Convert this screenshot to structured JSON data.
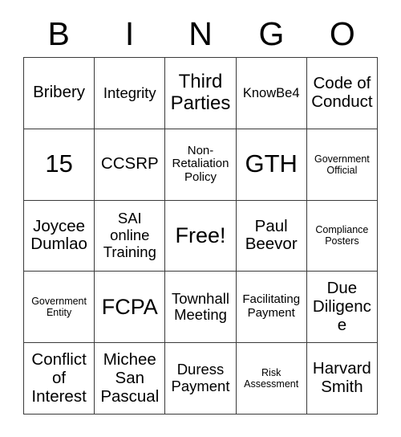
{
  "card": {
    "title": "BINGO Card",
    "header_letters": [
      "B",
      "I",
      "N",
      "G",
      "O"
    ],
    "columns": 5,
    "rows": 5,
    "colors": {
      "background": "#ffffff",
      "text": "#000000",
      "grid_line": "#3a3a3a"
    },
    "cells": [
      {
        "text": "Bribery",
        "size": "fs-l"
      },
      {
        "text": "Integrity",
        "size": "fs-ml"
      },
      {
        "text": "Third Parties",
        "size": "fs-xl"
      },
      {
        "text": "KnowBe4",
        "size": "fs-m"
      },
      {
        "text": "Code of Conduct",
        "size": "fs-l"
      },
      {
        "text": "15",
        "size": "fs-3xl"
      },
      {
        "text": "CCSRP",
        "size": "fs-l"
      },
      {
        "text": "Non-Retaliation Policy",
        "size": "fs-s"
      },
      {
        "text": "GTH",
        "size": "fs-3xl"
      },
      {
        "text": "Government Official",
        "size": "fs-xs"
      },
      {
        "text": "Joycee Dumlao",
        "size": "fs-l"
      },
      {
        "text": "SAI online Training",
        "size": "fs-ml"
      },
      {
        "text": "Free!",
        "size": "fs-2xl"
      },
      {
        "text": "Paul Beevor",
        "size": "fs-l"
      },
      {
        "text": "Compliance Posters",
        "size": "fs-xs"
      },
      {
        "text": "Government Entity",
        "size": "fs-xs"
      },
      {
        "text": "FCPA",
        "size": "fs-2xl"
      },
      {
        "text": "Townhall Meeting",
        "size": "fs-ml"
      },
      {
        "text": "Facilitating Payment",
        "size": "fs-s"
      },
      {
        "text": "Due Diligence",
        "size": "fs-l"
      },
      {
        "text": "Conflict of Interest",
        "size": "fs-l"
      },
      {
        "text": "Michee San Pascual",
        "size": "fs-l"
      },
      {
        "text": "Duress Payment",
        "size": "fs-ml"
      },
      {
        "text": "Risk Assessment",
        "size": "fs-xs"
      },
      {
        "text": "Harvard Smith",
        "size": "fs-l"
      }
    ]
  }
}
